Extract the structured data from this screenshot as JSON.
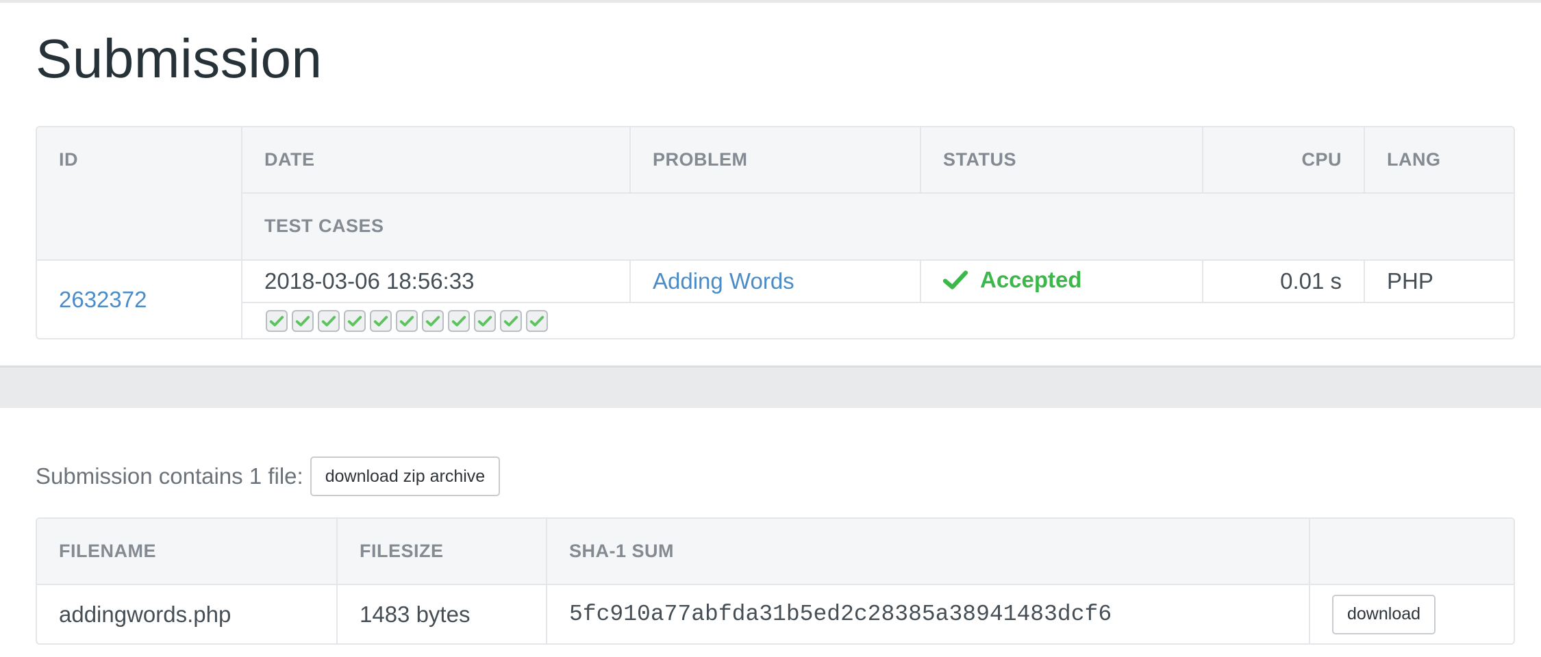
{
  "page": {
    "title": "Submission"
  },
  "submission_table": {
    "headers": {
      "id": "ID",
      "date": "DATE",
      "problem": "PROBLEM",
      "status": "STATUS",
      "cpu": "CPU",
      "lang": "LANG",
      "test_cases": "TEST CASES"
    },
    "row": {
      "id": "2632372",
      "date": "2018-03-06 18:56:33",
      "problem": "Adding Words",
      "status": "Accepted",
      "cpu": "0.01 s",
      "lang": "PHP"
    },
    "test_cases": [
      "passed",
      "passed",
      "passed",
      "passed",
      "passed",
      "passed",
      "passed",
      "passed",
      "passed",
      "passed",
      "passed"
    ]
  },
  "files": {
    "summary": "Submission contains 1 file:",
    "zip_button": "download zip archive",
    "headers": {
      "filename": "FILENAME",
      "filesize": "FILESIZE",
      "sha1": "SHA-1 SUM",
      "action": ""
    },
    "rows": [
      {
        "filename": "addingwords.php",
        "filesize": "1483 bytes",
        "sha1": "5fc910a77abfda31b5ed2c28385a38941483dcf6",
        "action": "download"
      }
    ]
  },
  "colors": {
    "accent_link": "#4a8cc8",
    "accepted": "#3cb84b",
    "test_pass": "#5cc35e"
  },
  "icons": {
    "status": "check-icon",
    "test_case": "check-icon"
  }
}
